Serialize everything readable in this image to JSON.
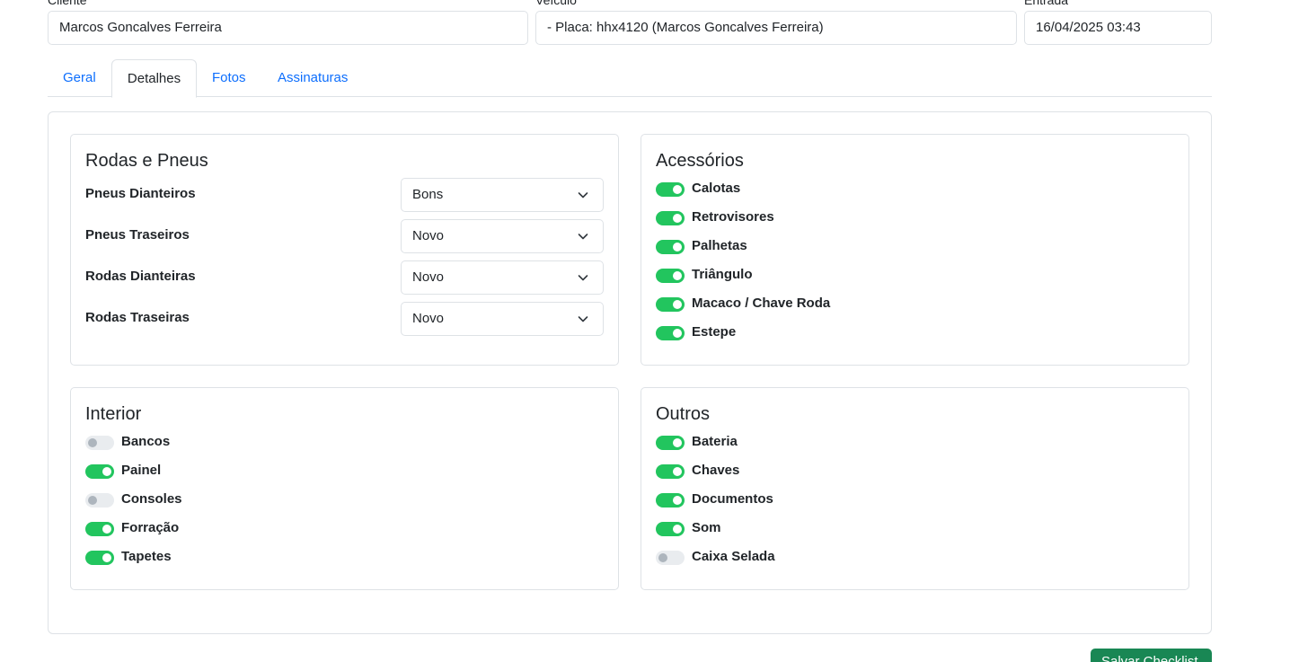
{
  "header": {
    "cliente": {
      "label": "Cliente",
      "value": "Marcos Goncalves Ferreira"
    },
    "veiculo": {
      "label": "Veículo",
      "value": "- Placa: hhx4120 (Marcos Goncalves Ferreira)"
    },
    "entrada": {
      "label": "Entrada",
      "value": "16/04/2025 03:43"
    }
  },
  "tabs": [
    "Geral",
    "Detalhes",
    "Fotos",
    "Assinaturas"
  ],
  "active_tab": "Detalhes",
  "rodas_pneus": {
    "title": "Rodas e Pneus",
    "rows": [
      {
        "label": "Pneus Dianteiros",
        "value": "Bons"
      },
      {
        "label": "Pneus Traseiros",
        "value": "Novo"
      },
      {
        "label": "Rodas Dianteiras",
        "value": "Novo"
      },
      {
        "label": "Rodas Traseiras",
        "value": "Novo"
      }
    ]
  },
  "acessorios": {
    "title": "Acessórios",
    "items": [
      {
        "label": "Calotas",
        "checked": true
      },
      {
        "label": "Retrovisores",
        "checked": true
      },
      {
        "label": "Palhetas",
        "checked": true
      },
      {
        "label": "Triângulo",
        "checked": true
      },
      {
        "label": "Macaco / Chave Roda",
        "checked": true
      },
      {
        "label": "Estepe",
        "checked": true
      }
    ]
  },
  "interior": {
    "title": "Interior",
    "items": [
      {
        "label": "Bancos",
        "checked": false
      },
      {
        "label": "Painel",
        "checked": true
      },
      {
        "label": "Consoles",
        "checked": false
      },
      {
        "label": "Forração",
        "checked": true
      },
      {
        "label": "Tapetes",
        "checked": true
      }
    ]
  },
  "outros": {
    "title": "Outros",
    "items": [
      {
        "label": "Bateria",
        "checked": true
      },
      {
        "label": "Chaves",
        "checked": true
      },
      {
        "label": "Documentos",
        "checked": true
      },
      {
        "label": "Som",
        "checked": true
      },
      {
        "label": "Caixa Selada",
        "checked": false
      }
    ]
  },
  "save_button": {
    "label": "Salvar Checklist"
  },
  "colors": {
    "toggle_on": "#22c55e",
    "toggle_off": "#e9ecef",
    "link": "#0d6efd",
    "save_button": "#198754",
    "border": "#dee2e6"
  },
  "icons": {
    "select_caret": "chevron-down-icon"
  }
}
